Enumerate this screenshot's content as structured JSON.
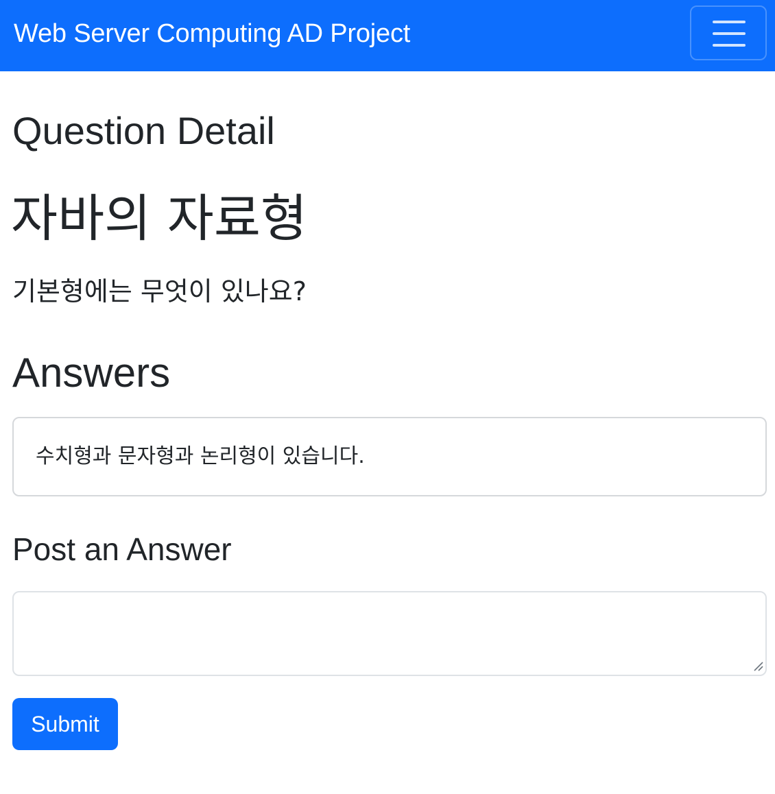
{
  "navbar": {
    "brand": "Web Server Computing AD Project",
    "toggler_icon": "hamburger-icon"
  },
  "page": {
    "heading": "Question Detail"
  },
  "question": {
    "title": "자바의 자료형",
    "body": "기본형에는 무엇이 있나요?"
  },
  "answers": {
    "heading": "Answers",
    "items": [
      {
        "content": "수치형과 문자형과 논리형이 있습니다."
      }
    ]
  },
  "post_answer": {
    "heading": "Post an Answer",
    "input_value": "",
    "submit_label": "Submit",
    "resize_icon": "resize-grip-icon"
  },
  "colors": {
    "primary": "#0d6efd",
    "text": "#212529",
    "border": "#dee2e6"
  }
}
